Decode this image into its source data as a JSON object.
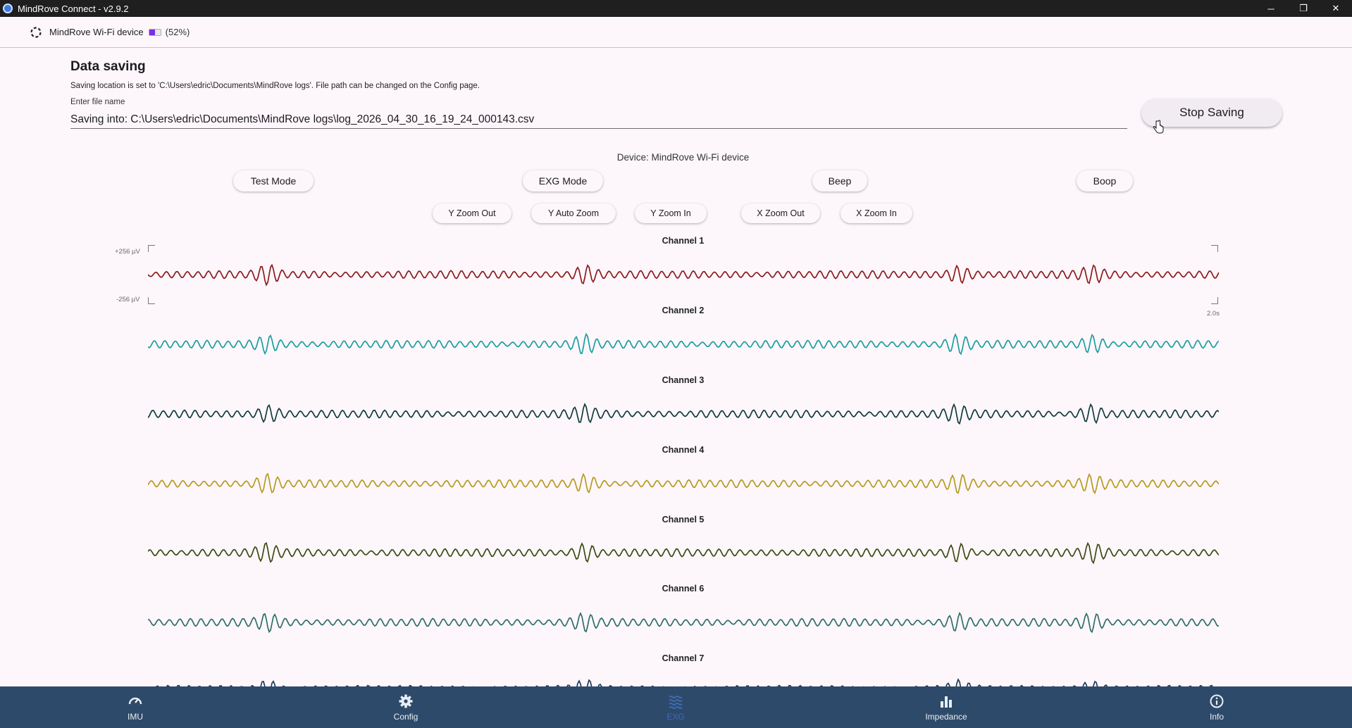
{
  "window": {
    "title": "MindRove Connect - v2.9.2",
    "minimize": "─",
    "restore": "❐",
    "close": "✕"
  },
  "header": {
    "device_name": "MindRove Wi-Fi device",
    "battery_percent_label": "(52%)",
    "battery_level": 0.52,
    "battery_color": "#7a2fe0"
  },
  "data_saving": {
    "title": "Data saving",
    "location_text": "Saving location is set to 'C:\\Users\\edric\\Documents\\MindRove logs'. File path can be changed on the Config page.",
    "file_label": "Enter file name",
    "file_value": "Saving into: C:\\Users\\edric\\Documents\\MindRove logs\\log_2026_04_30_16_19_24_000143.csv",
    "stop_label": "Stop Saving"
  },
  "device_label": "Device: MindRove Wi-Fi device",
  "mode_buttons": {
    "test_mode": "Test Mode",
    "exg_mode": "EXG Mode",
    "beep": "Beep",
    "boop": "Boop"
  },
  "zoom_buttons": {
    "y_zoom_out": "Y Zoom Out",
    "y_auto_zoom": "Y Auto Zoom",
    "y_zoom_in": "Y Zoom In",
    "x_zoom_out": "X Zoom Out",
    "x_zoom_in": "X Zoom In"
  },
  "plot_axis": {
    "y_max": "+256 µV",
    "y_min": "-256 µV",
    "x_span": "2.0s"
  },
  "channels": [
    {
      "title": "Channel 1",
      "color": "#8b1a1a"
    },
    {
      "title": "Channel 2",
      "color": "#1a9e9e"
    },
    {
      "title": "Channel 3",
      "color": "#0f3b3b"
    },
    {
      "title": "Channel 4",
      "color": "#b59a1e"
    },
    {
      "title": "Channel 5",
      "color": "#3a4a10"
    },
    {
      "title": "Channel 6",
      "color": "#2e6e68"
    },
    {
      "title": "Channel 7",
      "color": "#1f3c52"
    }
  ],
  "bottom_nav": {
    "imu": "IMU",
    "config": "Config",
    "exg": "EXG",
    "impedance": "Impedance",
    "info": "Info",
    "active_color": "#3f6bb5",
    "bar_color": "#2e4a6a"
  }
}
